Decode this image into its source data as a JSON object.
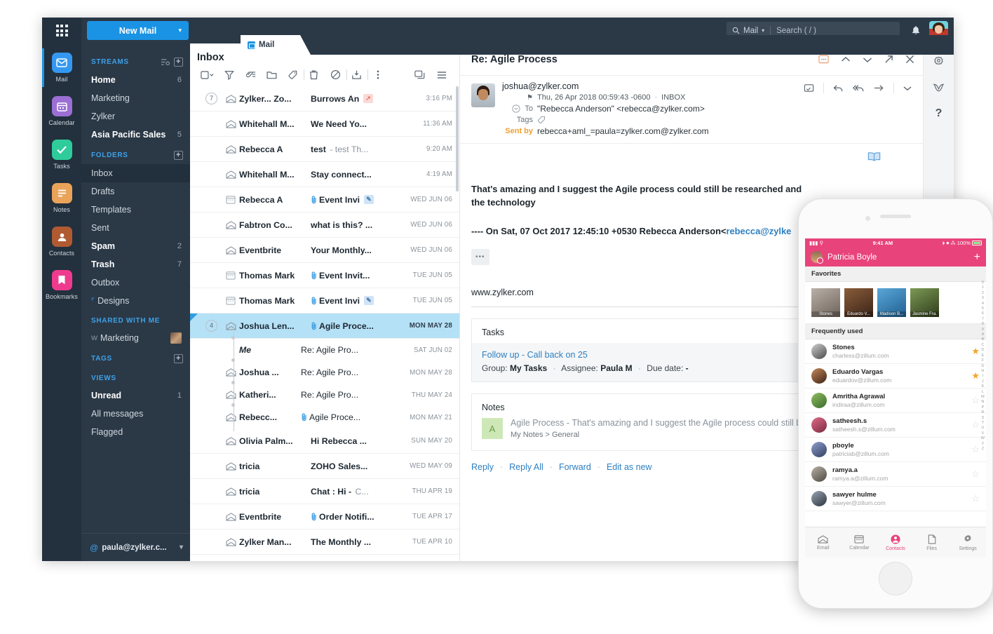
{
  "topbar": {
    "new_mail_label": "New Mail",
    "search_scope": "Mail",
    "search_placeholder": "Search ( / )"
  },
  "rail": {
    "items": [
      {
        "label": "Mail",
        "icon": "mail-icon",
        "color": "#3498f0",
        "active": true
      },
      {
        "label": "Calendar",
        "icon": "calendar-icon",
        "color": "#9b6fd4",
        "active": false
      },
      {
        "label": "Tasks",
        "icon": "tasks-check-icon",
        "color": "#2ecc9a",
        "active": false
      },
      {
        "label": "Notes",
        "icon": "notes-icon",
        "color": "#e9a45a",
        "active": false
      },
      {
        "label": "Contacts",
        "icon": "contacts-icon",
        "color": "#b05a32",
        "active": false
      },
      {
        "label": "Bookmarks",
        "icon": "bookmarks-icon",
        "color": "#ef3b8e",
        "active": false
      }
    ]
  },
  "sidebar": {
    "streams_header": "STREAMS",
    "streams": [
      {
        "label": "Home",
        "count": "6",
        "bold": true
      },
      {
        "label": "Marketing",
        "count": "",
        "bold": false
      },
      {
        "label": "Zylker",
        "count": "",
        "bold": false
      },
      {
        "label": "Asia Pacific Sales",
        "count": "5",
        "bold": true
      }
    ],
    "folders_header": "FOLDERS",
    "folders": [
      {
        "label": "Inbox",
        "count": "",
        "bold": false,
        "active": true
      },
      {
        "label": "Drafts",
        "count": "",
        "bold": false,
        "active": false
      },
      {
        "label": "Templates",
        "count": "",
        "bold": false,
        "active": false
      },
      {
        "label": "Sent",
        "count": "",
        "bold": false,
        "active": false
      },
      {
        "label": "Spam",
        "count": "2",
        "bold": true,
        "active": false
      },
      {
        "label": "Trash",
        "count": "7",
        "bold": true,
        "active": false
      },
      {
        "label": "Outbox",
        "count": "",
        "bold": false,
        "active": false
      },
      {
        "label": "Designs",
        "count": "",
        "bold": false,
        "active": false,
        "shared_icon": true
      }
    ],
    "shared_header": "SHARED WITH ME",
    "shared": [
      {
        "prefix": "W",
        "label": "Marketing"
      }
    ],
    "tags_header": "TAGS",
    "views_header": "VIEWS",
    "views": [
      {
        "label": "Unread",
        "count": "1",
        "bold": true
      },
      {
        "label": "All messages",
        "count": "",
        "bold": false
      },
      {
        "label": "Flagged",
        "count": "",
        "bold": false
      }
    ],
    "account": "paula@zylker.c..."
  },
  "tab": {
    "label": "Mail"
  },
  "maillist": {
    "title": "Inbox",
    "toolbar": [
      "select-all-checkbox",
      "filter-icon",
      "attachment-list-icon",
      "folder-icon",
      "tag-icon",
      "delete-icon",
      "spam-block-icon",
      "archive-icon",
      "more-options-icon",
      "conversation-view-icon",
      "view-options-icon"
    ],
    "rows": [
      {
        "count": "7",
        "icon": "envelope-icon",
        "from": "Zylker... Zo...",
        "subject": "Burrows An",
        "sub2": "",
        "date": "3:16 PM",
        "badge": "share-pink",
        "attach": false,
        "selected": false,
        "thread": false
      },
      {
        "count": "",
        "icon": "envelope-icon",
        "from": "Whitehall M...",
        "subject": "We Need Yo...",
        "sub2": "",
        "date": "11:36 AM",
        "badge": "",
        "attach": false,
        "selected": false,
        "thread": false
      },
      {
        "count": "",
        "icon": "envelope-icon",
        "from": "Rebecca A",
        "subject": "test",
        "sub2": "- test Th...",
        "date": "9:20 AM",
        "badge": "",
        "attach": false,
        "selected": false,
        "thread": false
      },
      {
        "count": "",
        "icon": "envelope-icon",
        "from": "Whitehall M...",
        "subject": "Stay connect...",
        "sub2": "",
        "date": "4:19 AM",
        "badge": "",
        "attach": false,
        "selected": false,
        "thread": false
      },
      {
        "count": "",
        "icon": "calendar-icon",
        "from": "Rebecca A",
        "subject": "Event Invi",
        "sub2": "",
        "date": "WED JUN 06",
        "badge": "task-blue",
        "attach": true,
        "selected": false,
        "thread": false
      },
      {
        "count": "",
        "icon": "envelope-icon",
        "from": "Fabtron Co...",
        "subject": "what is this? ...",
        "sub2": "",
        "date": "WED JUN 06",
        "badge": "",
        "attach": false,
        "selected": false,
        "thread": false
      },
      {
        "count": "",
        "icon": "envelope-icon",
        "from": "Eventbrite",
        "subject": "Your Monthly...",
        "sub2": "",
        "date": "WED JUN 06",
        "badge": "",
        "attach": false,
        "selected": false,
        "thread": false
      },
      {
        "count": "",
        "icon": "calendar-icon",
        "from": "Thomas Mark",
        "subject": "Event Invit...",
        "sub2": "",
        "date": "TUE JUN 05",
        "badge": "",
        "attach": true,
        "selected": false,
        "thread": false
      },
      {
        "count": "",
        "icon": "calendar-icon",
        "from": "Thomas Mark",
        "subject": "Event Invi",
        "sub2": "",
        "date": "TUE JUN 05",
        "badge": "task-blue",
        "attach": true,
        "selected": false,
        "thread": false
      },
      {
        "count": "4",
        "icon": "envelope-icon",
        "from": "Joshua Len...",
        "subject": "Agile Proce...",
        "sub2": "",
        "date": "MON MAY 28",
        "badge": "",
        "attach": true,
        "selected": true,
        "thread": false
      },
      {
        "count": "",
        "icon": "",
        "from": "Me",
        "subject": "Re: Agile Pro...",
        "sub2": "",
        "date": "SAT JUN 02",
        "badge": "",
        "attach": false,
        "selected": false,
        "thread": true,
        "italic": true
      },
      {
        "count": "",
        "icon": "envelope-icon",
        "from": "Joshua ...",
        "subject": "Re: Agile Pro...",
        "sub2": "",
        "date": "MON MAY 28",
        "badge": "",
        "attach": false,
        "selected": false,
        "thread": true
      },
      {
        "count": "",
        "icon": "envelope-icon",
        "from": "Katheri...",
        "subject": "Re: Agile Pro...",
        "sub2": "",
        "date": "THU MAY 24",
        "badge": "",
        "attach": false,
        "selected": false,
        "thread": true
      },
      {
        "count": "",
        "icon": "envelope-icon",
        "from": "Rebecc...",
        "subject": "Agile Proce...",
        "sub2": "",
        "date": "MON MAY 21",
        "badge": "",
        "attach": true,
        "selected": false,
        "thread": true
      },
      {
        "count": "",
        "icon": "envelope-icon",
        "from": "Olivia Palm...",
        "subject": "Hi Rebecca ...",
        "sub2": "",
        "date": "SUN MAY 20",
        "badge": "",
        "attach": false,
        "selected": false,
        "thread": false
      },
      {
        "count": "",
        "icon": "envelope-icon",
        "from": "tricia",
        "subject": "ZOHO Sales...",
        "sub2": "",
        "date": "WED MAY 09",
        "badge": "",
        "attach": false,
        "selected": false,
        "thread": false
      },
      {
        "count": "",
        "icon": "envelope-icon",
        "from": "tricia",
        "subject": "Chat : Hi -",
        "sub2": "C...",
        "date": "THU APR 19",
        "badge": "",
        "attach": false,
        "selected": false,
        "thread": false
      },
      {
        "count": "",
        "icon": "envelope-icon",
        "from": "Eventbrite",
        "subject": "Order Notifi...",
        "sub2": "",
        "date": "TUE APR 17",
        "badge": "",
        "attach": true,
        "selected": false,
        "thread": false
      },
      {
        "count": "",
        "icon": "envelope-icon",
        "from": "Zylker Man...",
        "subject": "The Monthly ...",
        "sub2": "",
        "date": "TUE APR 10",
        "badge": "",
        "attach": false,
        "selected": false,
        "thread": false
      }
    ]
  },
  "reader": {
    "subject": "Re: Agile Process",
    "top_icons": [
      "translate-icon",
      "previous-icon",
      "next-icon",
      "popout-icon",
      "close-icon"
    ],
    "sender_email": "joshua@zylker.com",
    "date": "Thu, 26 Apr 2018 00:59:43 -0600",
    "folder": "INBOX",
    "to_label": "To",
    "to_value": "\"Rebecca Anderson\" <rebecca@zylker.com>",
    "tags_label": "Tags",
    "sentby_label": "Sent by",
    "sentby_value": "rebecca+aml_=paula=zylker.com@zylker.com",
    "header_actions": [
      "print-icon",
      "reply-icon",
      "reply-all-icon",
      "forward-icon",
      "more-chevron-icon"
    ],
    "reading_mode_icon": "book-open-icon",
    "body_p1": "That's amazing  and I suggest the Agile process could still be researched and",
    "body_p1b": "the technology",
    "quote_prefix": "---- On Sat, 07 Oct 2017 12:45:10 +0530 Rebecca Anderson<",
    "quote_link": "rebecca@zylke",
    "ellipsis": "•••",
    "signature": "www.zylker.com",
    "tasks_header": "Tasks",
    "task_title": "Follow up - Call back on 25",
    "task_group_label": "Group:",
    "task_group": "My Tasks",
    "task_assignee_label": "Assignee:",
    "task_assignee": "Paula M",
    "task_due_label": "Due date:",
    "task_due": "-",
    "notes_header": "Notes",
    "note_avatar": "A",
    "note_title": "Agile Process",
    "note_excerpt": "- That's amazing and I suggest the Agile process could still be res",
    "note_path": "My Notes > General",
    "actions": [
      "Reply",
      "Reply All",
      "Forward",
      "Edit as new"
    ]
  },
  "right_rail": {
    "icons": [
      "gear-icon",
      "bird-icon",
      "help-icon"
    ]
  },
  "phone": {
    "status_time": "9:41 AM",
    "status_battery": "100%",
    "header_name": "Patricia Boyle",
    "favorites_header": "Favorites",
    "favorites": [
      {
        "name": "Stones",
        "color1": "#b9b0a8",
        "color2": "#6d6259"
      },
      {
        "name": "Eduardo V...",
        "color1": "#8a5c3a",
        "color2": "#3a2418"
      },
      {
        "name": "Madison B...",
        "color1": "#5ba7d8",
        "color2": "#1f5f91"
      },
      {
        "name": "Jasmine Fra.",
        "color1": "#7c9a55",
        "color2": "#2e3b1b"
      }
    ],
    "frequent_header": "Frequently used",
    "contacts": [
      {
        "name": "Stones",
        "email": "charless@zillum.com",
        "starred": true,
        "c1": "#cfcfcf",
        "c2": "#4a4a4a"
      },
      {
        "name": "Eduardo Vargas",
        "email": "eduardov@zillum.com",
        "starred": true,
        "c1": "#c58a5c",
        "c2": "#3e2415"
      },
      {
        "name": "Amritha Agrawal",
        "email": "indiraa@zillum.com",
        "starred": false,
        "c1": "#8fbf63",
        "c2": "#3b6b2a"
      },
      {
        "name": "satheesh.s",
        "email": "satheesh.s@zillum.com",
        "starred": false,
        "c1": "#e06c8a",
        "c2": "#7c2a3f"
      },
      {
        "name": "pboyle",
        "email": "patriciab@zillum.com",
        "starred": false,
        "c1": "#8f9fd0",
        "c2": "#33405f"
      },
      {
        "name": "ramya.a",
        "email": "ramya.a@zillum.com",
        "starred": false,
        "c1": "#b7b0a4",
        "c2": "#4f4a43"
      },
      {
        "name": "sawyer hulme",
        "email": "sawyer@zillum.com",
        "starred": false,
        "c1": "#9aa6b2",
        "c2": "#2c3540"
      }
    ],
    "alpha_index": "0123456789ABCDEFGHIJKLMNPRSTUVWYZ",
    "tabs": [
      {
        "label": "Email",
        "icon": "email-icon",
        "active": false
      },
      {
        "label": "Calendar",
        "icon": "calendar-icon",
        "active": false
      },
      {
        "label": "Contacts",
        "icon": "contacts-icon",
        "active": true
      },
      {
        "label": "Files",
        "icon": "files-icon",
        "active": false
      },
      {
        "label": "Settings",
        "icon": "settings-gear-icon",
        "active": false
      }
    ]
  }
}
